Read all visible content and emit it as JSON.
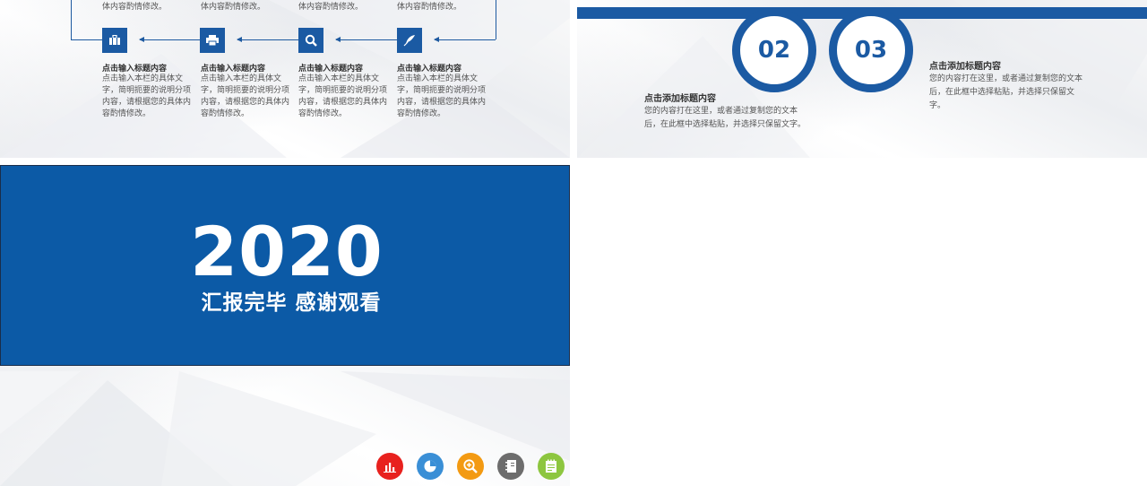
{
  "slide1": {
    "top_texts": [
      "体内容酌情修改。",
      "体内容酌情修改。",
      "体内容酌情修改。",
      "体内容酌情修改。"
    ],
    "steps": [
      {
        "icon": "briefcase-icon",
        "title": "点击输入标题内容",
        "desc": "点击输入本栏的具体文字，简明扼要的说明分项内容，请根据您的具体内容酌情修改。"
      },
      {
        "icon": "printer-icon",
        "title": "点击输入标题内容",
        "desc": "点击输入本栏的具体文字，简明扼要的说明分项内容，请根据您的具体内容酌情修改。"
      },
      {
        "icon": "magnifier-icon",
        "title": "点击输入标题内容",
        "desc": "点击输入本栏的具体文字，简明扼要的说明分项内容，请根据您的具体内容酌情修改。"
      },
      {
        "icon": "quill-icon",
        "title": "点击输入标题内容",
        "desc": "点击输入本栏的具体文字，简明扼要的说明分项内容，请根据您的具体内容酌情修改。"
      }
    ],
    "accent": "#1b5aa3"
  },
  "slide2": {
    "circles": [
      "02",
      "03"
    ],
    "block_left": {
      "title": "点击添加标题内容",
      "desc": "您的内容打在这里，或者通过复制您的文本后，在此框中选择粘贴，并选择只保留文字。"
    },
    "block_right": {
      "title": "点击添加标题内容",
      "desc": "您的内容打在这里，或者通过复制您的文本后，在此框中选择粘贴，并选择只保留文字。"
    }
  },
  "slide3": {
    "year": "2020",
    "thanks": "汇报完毕  感谢观看",
    "banner_color": "#0c5aa6",
    "icons": [
      {
        "name": "bar-chart-icon",
        "color": "#e8211e"
      },
      {
        "name": "pie-chart-icon",
        "color": "#3a8fd6"
      },
      {
        "name": "zoom-in-icon",
        "color": "#f39a12"
      },
      {
        "name": "notebook-icon",
        "color": "#6d6d6d"
      },
      {
        "name": "notepad-icon",
        "color": "#8dc63f"
      }
    ]
  }
}
